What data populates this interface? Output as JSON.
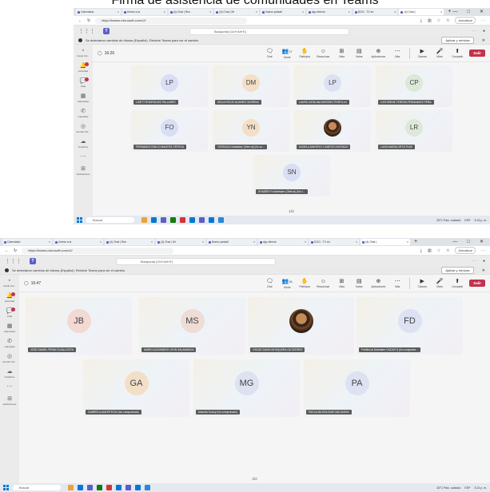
{
  "caption": "Firma de asistencia de comunidades en Teams",
  "browser": {
    "tabs": [
      "Calendario",
      "Unirse a la",
      "(4) Chat | Reu",
      "(4) Chat | Mi",
      "Nuevo pestañ",
      "dgo directo",
      "DGO - TV en",
      "(4) Chat |"
    ],
    "url": "https://teams.microsoft.com/v2/",
    "actualizar": "Actualizar"
  },
  "teams": {
    "search_placeholder": "Búsqueda (Ctrl+Alt+E)",
    "banner_text": "Se detectaron cambios de idioma (Español). Reinicie Teams para ver el cambio.",
    "banner_button": "Aplicar y reiniciar",
    "rail": [
      {
        "label": "Canal Unl...",
        "icon": "⋆"
      },
      {
        "label": "Actividad",
        "icon": "🔔"
      },
      {
        "label": "Chat",
        "icon": "💬"
      },
      {
        "label": "Calendario",
        "icon": "▦"
      },
      {
        "label": "Llamadas",
        "icon": "✆"
      },
      {
        "label": "Arenda Virt...",
        "icon": "◎"
      },
      {
        "label": "OneDrive",
        "icon": "☁"
      },
      {
        "label": "",
        "icon": "⋯"
      },
      {
        "label": "Aplicaciones",
        "icon": "⊞"
      }
    ],
    "tools": [
      {
        "label": "Chat",
        "icon": "🗨"
      },
      {
        "label": "Gente",
        "icon": "👥"
      },
      {
        "label": "Participar",
        "icon": "✋"
      },
      {
        "label": "Reaccionar",
        "icon": "☺"
      },
      {
        "label": "Vista",
        "icon": "⊞"
      },
      {
        "label": "Notas",
        "icon": "▤"
      },
      {
        "label": "Aplicaciones",
        "icon": "⊕"
      },
      {
        "label": "Más",
        "icon": "⋯"
      }
    ],
    "av_tools": [
      {
        "label": "Cámara",
        "icon": "▶"
      },
      {
        "label": "Micro",
        "icon": "🎤"
      },
      {
        "label": "Compartir",
        "icon": "⬆"
      }
    ],
    "salir": "Salir"
  },
  "screen1": {
    "time": "16:26",
    "people_count": "17",
    "participants": [
      {
        "initials": "LP",
        "name": "LISETT RODRIGUEZ PALLARES"
      },
      {
        "initials": "DM",
        "name": "DELIA ROCIO ALVAREZ MORENO"
      },
      {
        "initials": "LP",
        "name": "LAURA CATALINA MORENO PORTILLO"
      },
      {
        "initials": "CP",
        "name": "CATHERINE TERESA FERNANDEZ PEÑA"
      },
      {
        "initials": "FO",
        "name": "FERNANDO EMILIO MANTES ORTEGA"
      },
      {
        "initials": "YN",
        "name": "YESSICA's Notetaker (Otter.ai) (No co..."
      },
      {
        "initials": "",
        "name": "ANGELA MAYERLY CAMPOS HURTADO"
      },
      {
        "initials": "LR",
        "name": "LUISA MARIA ORTIZ RUIZ"
      },
      {
        "initials": "SN",
        "name": "SHADREY's Notetaker (Otter.ai) (No c..."
      }
    ],
    "pager": "1/2"
  },
  "screen2": {
    "time": "16:47",
    "people_count": "16",
    "participants": [
      {
        "initials": "JB",
        "name": "JOSE DANIEL PERALTA BALLESTA"
      },
      {
        "initials": "MS",
        "name": "MARIO ALEJANDRO LEON SALAMANCA"
      },
      {
        "initials": "",
        "name": "OSCAR DAVID MOSQUERA GUTIERREZ"
      },
      {
        "initials": "FD",
        "name": "Fireflies.ai Notetaker OSCAR D (No comproba..."
      },
      {
        "initials": "GA",
        "name": "GABRIELA AMORTEGUI (No comprobado)"
      },
      {
        "initials": "MG",
        "name": "Marcela Godoy (No comprobado)"
      },
      {
        "initials": "PA",
        "name": "PAOLA MILENA BUELVAS ANAYA"
      }
    ],
    "pager": "2/2"
  },
  "taskbar": {
    "search": "Buscar",
    "weather": "33°C Parc. soleado",
    "lang": "ESP",
    "time": "3:13 p. m."
  }
}
